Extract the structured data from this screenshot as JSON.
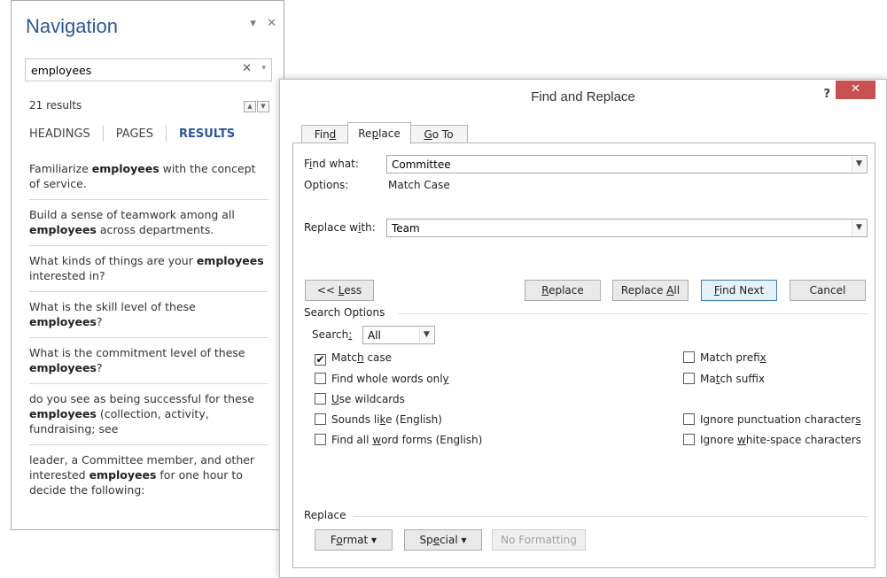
{
  "nav": {
    "title": "Navigation",
    "dropdown_glyph": "▾",
    "close_glyph": "✕",
    "search_value": "employees",
    "clear_glyph": "✕",
    "search_dd_glyph": "▾",
    "results_count": "21 results",
    "tabs": [
      "HEADINGS",
      "PAGES",
      "RESULTS"
    ],
    "results": [
      {
        "pre": "Familiarize ",
        "hit": "employees",
        "post": " with the concept of service."
      },
      {
        "pre": "Build a sense of teamwork among all ",
        "hit": "employees",
        "post": " across departments."
      },
      {
        "pre": "What kinds of things are your ",
        "hit": "employees",
        "post": " interested in?"
      },
      {
        "pre": "What is the skill level of these ",
        "hit": "employees",
        "post": "?"
      },
      {
        "pre": "What is the commitment level of these ",
        "hit": "employees",
        "post": "?"
      },
      {
        "pre": "do you see as being successful for these ",
        "hit": "employees",
        "post": " (collection, activity, fundraising; see"
      },
      {
        "pre": "leader, a Committee member, and other interested ",
        "hit": "employees",
        "post": " for one hour to decide the following:"
      }
    ]
  },
  "dialog": {
    "title": "Find and Replace",
    "help": "?",
    "close": "✕",
    "tabs": [
      "Find",
      "Replace",
      "Go To"
    ],
    "find_label": "Find what:",
    "find_value": "Committee",
    "options_label": "Options:",
    "options_value": "Match Case",
    "replace_label": "Replace with:",
    "replace_value": "Team",
    "buttons": {
      "less": "<< Less",
      "replace": "Replace",
      "replace_all": "Replace All",
      "find_next": "Find Next",
      "cancel": "Cancel"
    },
    "search_options_heading": "Search Options",
    "search_label": "Search:",
    "search_value": "All",
    "checkboxes_left": [
      {
        "label": "Match case",
        "checked": true
      },
      {
        "label": "Find whole words only",
        "checked": false
      },
      {
        "label": "Use wildcards",
        "checked": false
      },
      {
        "label": "Sounds like (English)",
        "checked": false
      },
      {
        "label": "Find all word forms (English)",
        "checked": false
      }
    ],
    "checkboxes_right": [
      {
        "label": "Match prefix",
        "checked": false
      },
      {
        "label": "Match suffix",
        "checked": false
      },
      {
        "label": "Ignore punctuation characters",
        "checked": false
      },
      {
        "label": "Ignore white-space characters",
        "checked": false
      }
    ],
    "replace_heading": "Replace",
    "format_button": "Format",
    "special_button": "Special",
    "no_formatting_button": "No Formatting",
    "arrow_glyph": "▾",
    "combo_arrow": "⌄"
  }
}
